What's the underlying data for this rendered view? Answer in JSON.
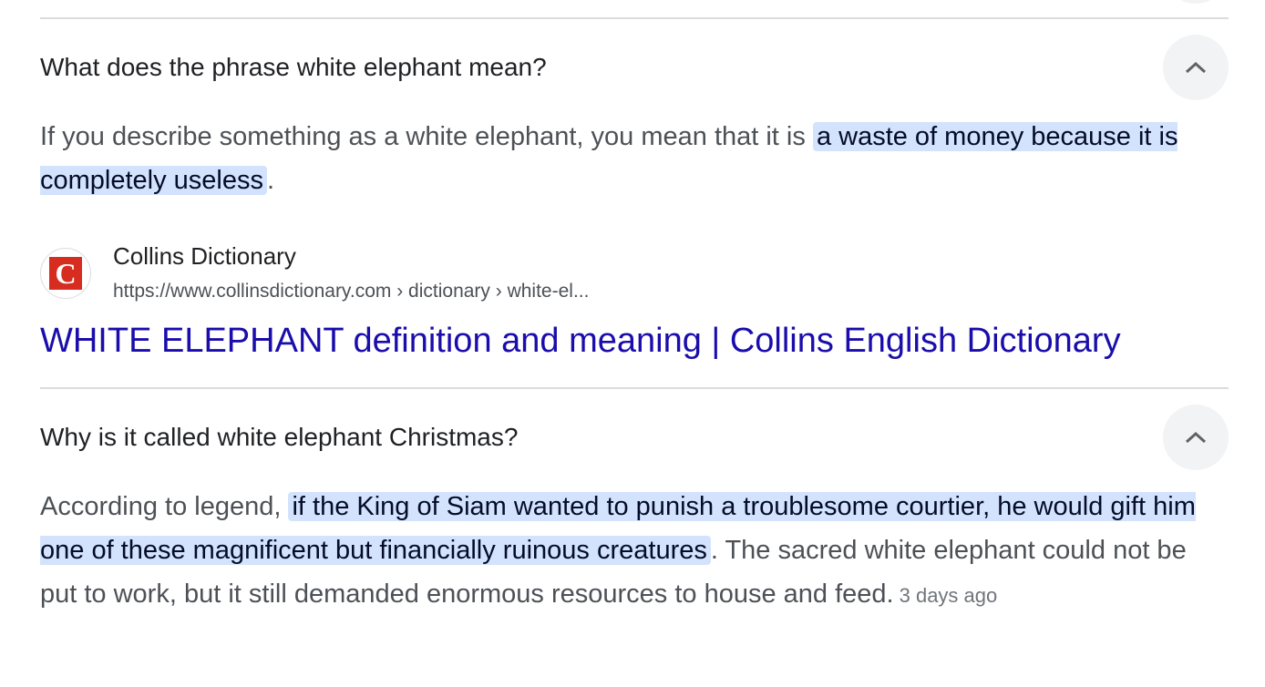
{
  "faq": [
    {
      "question": "What does the phrase white elephant mean?",
      "answer_before": "If you describe something as a white elephant, you mean that it is ",
      "answer_highlight": "a waste of money because it is completely useless",
      "answer_after": ".",
      "source": {
        "name": "Collins Dictionary",
        "url": "https://www.collinsdictionary.com › dictionary › white-el...",
        "favicon_letter": "C",
        "title": "WHITE ELEPHANT definition and meaning | Collins English Dictionary"
      }
    },
    {
      "question": "Why is it called white elephant Christmas?",
      "answer_before": "According to legend, ",
      "answer_highlight": "if the King of Siam wanted to punish a troublesome courtier, he would gift him one of these magnificent but financially ruinous creatures",
      "answer_after": ". The sacred white elephant could not be put to work, but it still demanded enormous resources to house and feed.",
      "date": "3 days ago"
    }
  ],
  "icons": {
    "toggle": "chevron-up-icon"
  },
  "colors": {
    "link": "#1a0dab",
    "highlight": "#d3e3fd",
    "favicon_brand": "#d62d20"
  }
}
